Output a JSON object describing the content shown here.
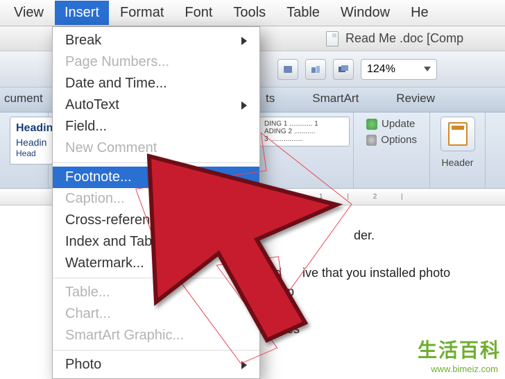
{
  "menubar": {
    "items": [
      "View",
      "Insert",
      "Format",
      "Font",
      "Tools",
      "Table",
      "Window",
      "He"
    ],
    "active_index": 1
  },
  "titlebar": {
    "filename": "Read Me .doc [Comp"
  },
  "qat": {
    "zoom_value": "124%"
  },
  "ribbon_tabs": {
    "partial_left": "cument",
    "tabs": [
      "ts",
      "SmartArt",
      "Review"
    ]
  },
  "ribbon": {
    "styles": {
      "h1": "Heading",
      "h2": "Headin",
      "h3": "Head"
    },
    "toc": {
      "line1": "DING 1 ............ 1",
      "line2": "ADING 2 ...........",
      "line3": "3 ................."
    },
    "update_group": {
      "update": "Update",
      "options": "Options"
    },
    "header_label": "Header"
  },
  "ruler": {
    "marks": "1   |   2   |"
  },
  "dropdown": {
    "items": [
      {
        "label": "Break",
        "enabled": true,
        "submenu": true
      },
      {
        "label": "Page Numbers...",
        "enabled": false
      },
      {
        "label": "Date and Time...",
        "enabled": true
      },
      {
        "label": "AutoText",
        "enabled": true,
        "submenu": true
      },
      {
        "label": "Field...",
        "enabled": true
      },
      {
        "label": "New Comment",
        "enabled": false
      },
      {
        "sep": true
      },
      {
        "label": "Footnote...",
        "enabled": true,
        "highlight": true
      },
      {
        "label": "Caption...",
        "enabled": false
      },
      {
        "label": "Cross-reference...",
        "enabled": true
      },
      {
        "label": "Index and Tables...",
        "enabled": true
      },
      {
        "label": "Watermark...",
        "enabled": true
      },
      {
        "sep": true
      },
      {
        "label": "Table...",
        "enabled": false
      },
      {
        "label": "Chart...",
        "enabled": false
      },
      {
        "label": "SmartArt Graphic...",
        "enabled": false
      },
      {
        "sep": true
      },
      {
        "label": "Photo",
        "enabled": true,
        "submenu": true
      }
    ]
  },
  "document": {
    "line1": "der.",
    "line2": "hard      ive that you installed photo",
    "line3": "toshop",
    "line4": "sets",
    "line5": "shes"
  },
  "watermark": {
    "zh": "生活百科",
    "url": "www.bimeiz.com"
  }
}
